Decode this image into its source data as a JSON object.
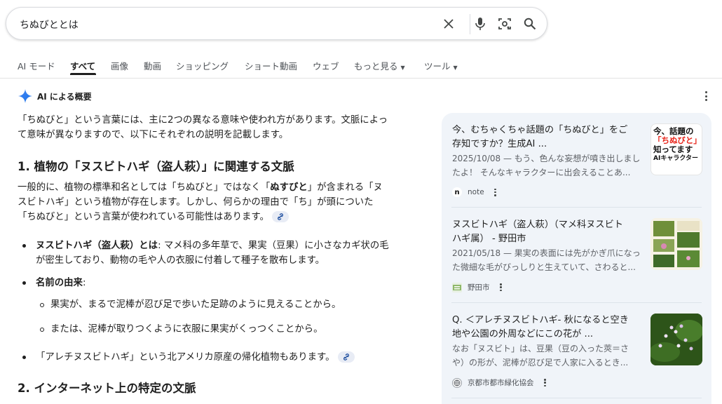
{
  "search": {
    "query": "ちぬびととは"
  },
  "tabs": [
    {
      "label": "AI モード"
    },
    {
      "label": "すべて"
    },
    {
      "label": "画像"
    },
    {
      "label": "動画"
    },
    {
      "label": "ショッピング"
    },
    {
      "label": "ショート動画"
    },
    {
      "label": "ウェブ"
    },
    {
      "label": "もっと見る"
    },
    {
      "label": "ツール"
    }
  ],
  "overview": {
    "title": "AI による概要",
    "intro_line1": "「ちぬびと」という言葉には、主に2つの異なる意味や使われ方があります。文脈によっ",
    "intro_line2": "て意味が異なりますので、以下にそれぞれの説明を記載します。",
    "section1_heading": "1. 植物の「ヌスビトハギ（盗人萩）」に関連する文脈",
    "s1_p_line1_a": "一般的に、植物の標準和名としては「ちぬびと」ではなく「",
    "s1_p_line1_bold": "ぬすびと",
    "s1_p_line1_b": "」が含まれる「ヌ",
    "s1_p_line2": "スビトハギ」という植物が存在します。しかし、何らかの理由で「ち」が頭についた",
    "s1_p_line3": "「ちぬびと」という言葉が使われている可能性はあります。",
    "bullet1_bold": "ヌスビトハギ（盗人萩）とは",
    "bullet1_line1": ": マメ科の多年草で、果実（豆果）に小さなカギ状の毛",
    "bullet1_line2": "が密生しており、動物の毛や人の衣服に付着して種子を散布します。",
    "bullet2_bold": "名前の由来",
    "bullet2_colon": ":",
    "sub1": "果実が、まるで泥棒が忍び足で歩いた足跡のように見えることから。",
    "sub2": "または、泥棒が取りつくように衣服に果実がくっつくことから。",
    "bullet3": "「アレチヌスビトハギ」という北アメリカ原産の帰化植物もあります。",
    "section2_heading": "2. インターネット上の特定の文脈"
  },
  "sources": [
    {
      "title_line1": "今、むちゃくちゃ話題の「ちぬびと」をご",
      "title_line2": "存知ですか？生成AI ...",
      "snippet_line1": "2025/10/08 — もう、色んな妄想が噴き出しまし",
      "snippet_line2": "たよ！ そんなキャラクターに出会えることあ...",
      "site": "note",
      "thumb_line1": "今、話題の",
      "thumb_line2": "「ちぬびと」",
      "thumb_line3": "知ってます",
      "thumb_line4": "AIキャラクター"
    },
    {
      "title_line1": "ヌスビトハギ（盗人萩）（マメ科ヌスビト",
      "title_line2": "ハギ属） - 野田市",
      "snippet_line1": "2021/05/18 — 果実の表面には先がかぎ爪になっ",
      "snippet_line2": "た微細な毛がびっしりと生えていて、さわると...",
      "site": "野田市"
    },
    {
      "title_line1": "Q. ＜アレチヌスビトハギ- 秋になると空き",
      "title_line2": "地や公園の外周などにこの花が ...",
      "snippet_line1": "なお「ヌスビト」は、豆果（豆の入った莢＝さ",
      "snippet_line2": "や）の形が、泥棒が忍び足で人家に入るとき...",
      "site": "京都市都市緑化協会"
    }
  ],
  "colors": {
    "accent": "#1a73e8",
    "panel_bg": "#f0f4f9"
  }
}
